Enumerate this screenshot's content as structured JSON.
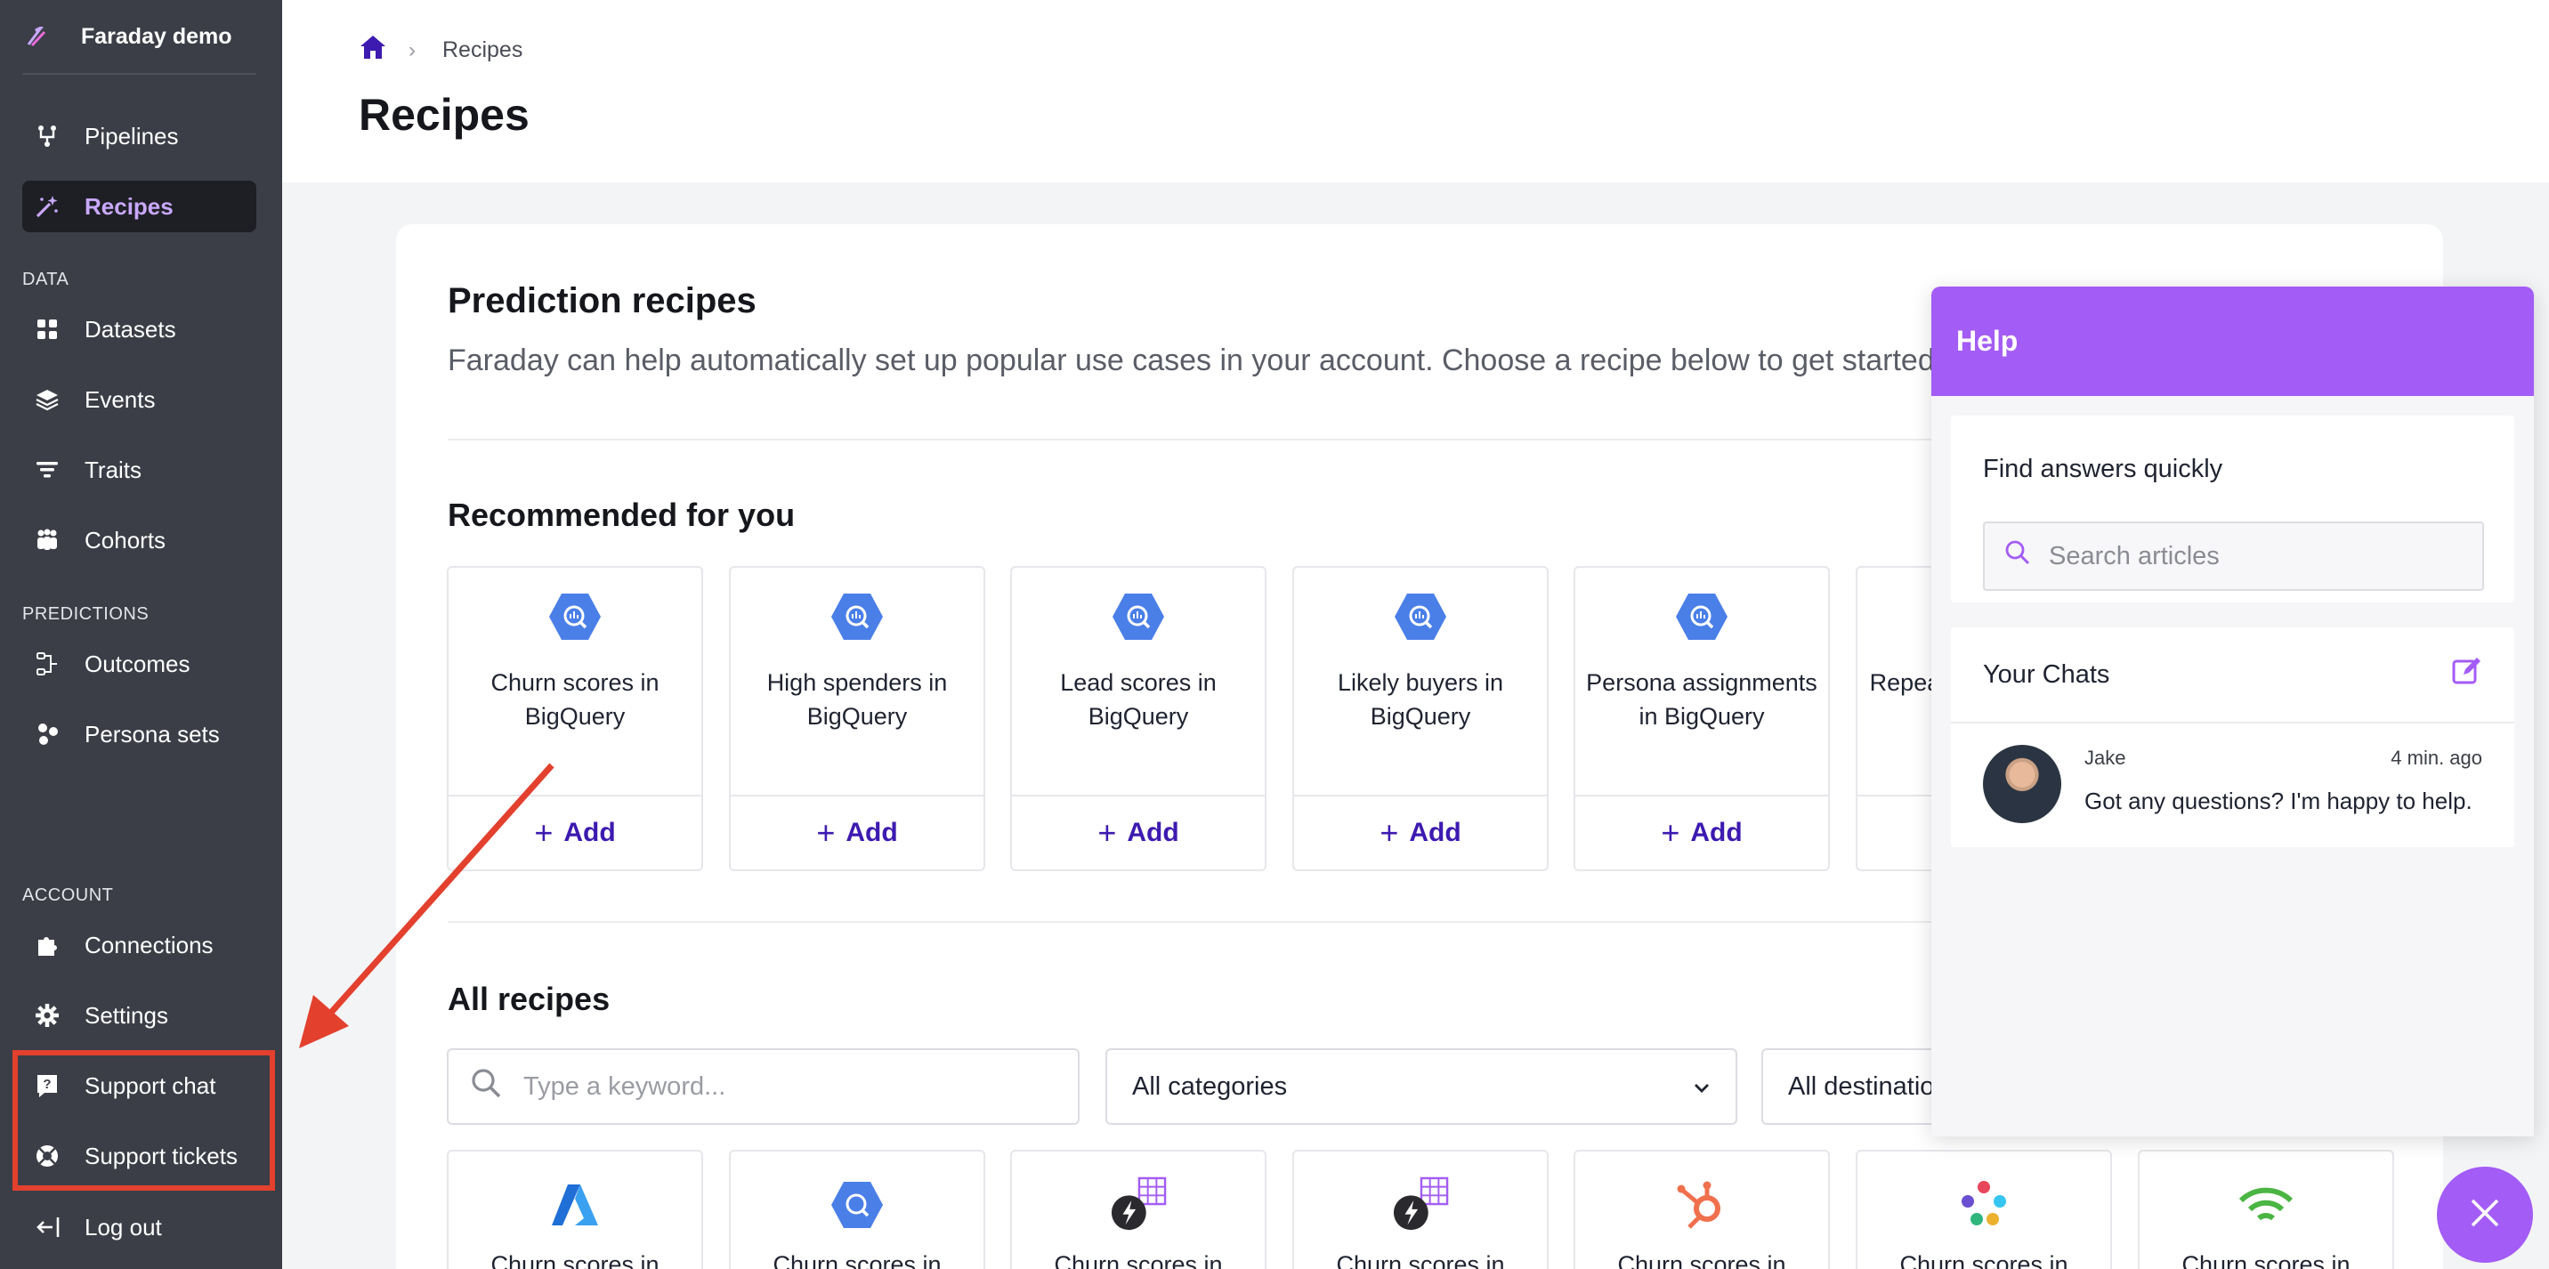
{
  "sidebar": {
    "brand": "Faraday demo",
    "items_top": [
      {
        "label": "Pipelines",
        "icon": "pipelines-icon"
      },
      {
        "label": "Recipes",
        "icon": "wand-icon",
        "active": true
      }
    ],
    "section_data": "DATA",
    "items_data": [
      {
        "label": "Datasets",
        "icon": "grid-icon"
      },
      {
        "label": "Events",
        "icon": "layers-icon"
      },
      {
        "label": "Traits",
        "icon": "filter-icon"
      },
      {
        "label": "Cohorts",
        "icon": "people-icon"
      }
    ],
    "section_predictions": "PREDICTIONS",
    "items_predictions": [
      {
        "label": "Outcomes",
        "icon": "outcomes-icon"
      },
      {
        "label": "Persona sets",
        "icon": "persona-icon"
      }
    ],
    "section_account": "ACCOUNT",
    "items_account": [
      {
        "label": "Connections",
        "icon": "puzzle-icon"
      },
      {
        "label": "Settings",
        "icon": "gear-icon"
      },
      {
        "label": "Support chat",
        "icon": "question-chat-icon"
      },
      {
        "label": "Support tickets",
        "icon": "lifebuoy-icon"
      },
      {
        "label": "Log out",
        "icon": "logout-icon"
      }
    ],
    "highlight_color": "#e3402e"
  },
  "header": {
    "breadcrumb": "Recipes",
    "title": "Recipes"
  },
  "main": {
    "card_title": "Prediction recipes",
    "card_subtitle": "Faraday can help automatically set up popular use cases in your account. Choose a recipe below to get started.",
    "recommended_title": "Recommended for you",
    "recommended": [
      {
        "name": "Churn scores in BigQuery"
      },
      {
        "name": "High spenders in BigQuery"
      },
      {
        "name": "Lead scores in BigQuery"
      },
      {
        "name": "Likely buyers in BigQuery"
      },
      {
        "name": "Persona assignments in BigQuery"
      },
      {
        "name": "Repeat purchasers in BigQuery"
      }
    ],
    "add_label": "Add",
    "all_title": "All recipes",
    "keyword_placeholder": "Type a keyword...",
    "categories_select": "All categories",
    "destinations_select": "All destinations",
    "all_recipes": [
      {
        "name": "Churn scores in",
        "logo": "azure-icon"
      },
      {
        "name": "Churn scores in",
        "logo": "bigquery-icon"
      },
      {
        "name": "Churn scores in",
        "logo": "bolt-grid-icon"
      },
      {
        "name": "Churn scores in",
        "logo": "bolt-grid-icon"
      },
      {
        "name": "Churn scores in",
        "logo": "hubspot-icon"
      },
      {
        "name": "Churn scores in",
        "logo": "dots-icon"
      },
      {
        "name": "Churn scores in",
        "logo": "wifi-icon"
      }
    ]
  },
  "help": {
    "title": "Help",
    "find_label": "Find answers quickly",
    "search_placeholder": "Search articles",
    "chats_label": "Your Chats",
    "chat": {
      "name": "Jake",
      "time": "4 min. ago",
      "message": "Got any questions? I'm happy to help."
    },
    "accent": "#a35cf5"
  }
}
